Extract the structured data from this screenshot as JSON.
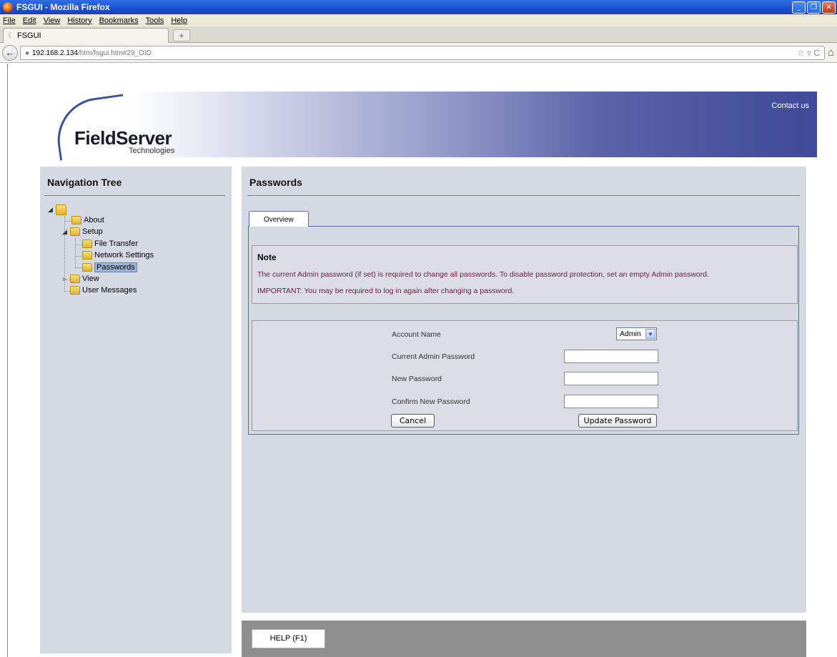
{
  "browser": {
    "window_title": "FSGUI - Mozilla Firefox",
    "menu": [
      "File",
      "Edit",
      "View",
      "History",
      "Bookmarks",
      "Tools",
      "Help"
    ],
    "tab_title": "FSGUI",
    "new_tab": "+",
    "url_host": "192.168.2.134",
    "url_path": "/htm/fsgui.htm#29_OID",
    "url_right_icons": "☆ ▿ C"
  },
  "banner": {
    "brand": "FieldServer",
    "brand_sub": "Technologies",
    "contact": "Contact us"
  },
  "nav": {
    "title": "Navigation Tree",
    "items": {
      "about": "About",
      "setup": "Setup",
      "file_transfer": "File Transfer",
      "network_settings": "Network Settings",
      "passwords": "Passwords",
      "view": "View",
      "user_messages": "User Messages"
    },
    "selected": "Passwords"
  },
  "content": {
    "title": "Passwords",
    "tab": "Overview",
    "note": {
      "heading": "Note",
      "line1": "The current Admin password (if set) is required to change all passwords. To disable password protection, set an empty Admin password.",
      "line2": "IMPORTANT: You may be required to log in again after changing a password."
    },
    "form": {
      "account_name_label": "Account Name",
      "account_name_value": "Admin",
      "current_password_label": "Current Admin Password",
      "new_password_label": "New Password",
      "confirm_password_label": "Confirm New Password",
      "cancel": "Cancel",
      "update": "Update Password"
    }
  },
  "help": {
    "button": "HELP (F1)"
  }
}
